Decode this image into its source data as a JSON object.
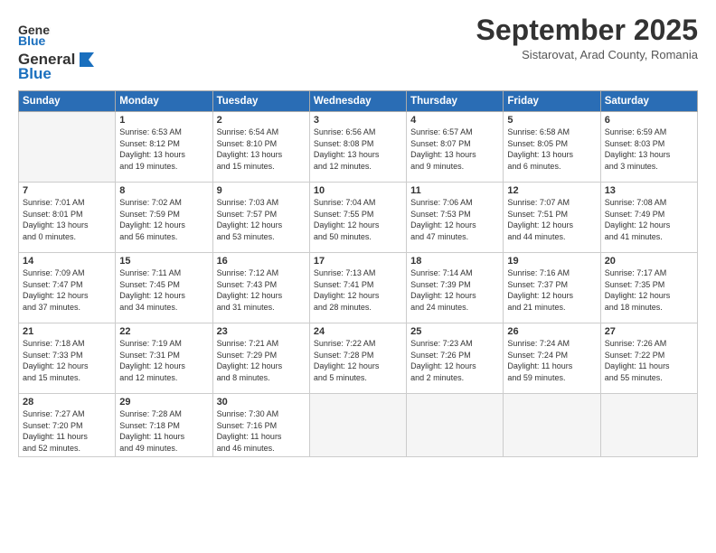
{
  "header": {
    "logo_general": "General",
    "logo_blue": "Blue",
    "month_title": "September 2025",
    "location": "Sistarovat, Arad County, Romania"
  },
  "weekdays": [
    "Sunday",
    "Monday",
    "Tuesday",
    "Wednesday",
    "Thursday",
    "Friday",
    "Saturday"
  ],
  "weeks": [
    [
      {
        "day": "",
        "info": ""
      },
      {
        "day": "1",
        "info": "Sunrise: 6:53 AM\nSunset: 8:12 PM\nDaylight: 13 hours\nand 19 minutes."
      },
      {
        "day": "2",
        "info": "Sunrise: 6:54 AM\nSunset: 8:10 PM\nDaylight: 13 hours\nand 15 minutes."
      },
      {
        "day": "3",
        "info": "Sunrise: 6:56 AM\nSunset: 8:08 PM\nDaylight: 13 hours\nand 12 minutes."
      },
      {
        "day": "4",
        "info": "Sunrise: 6:57 AM\nSunset: 8:07 PM\nDaylight: 13 hours\nand 9 minutes."
      },
      {
        "day": "5",
        "info": "Sunrise: 6:58 AM\nSunset: 8:05 PM\nDaylight: 13 hours\nand 6 minutes."
      },
      {
        "day": "6",
        "info": "Sunrise: 6:59 AM\nSunset: 8:03 PM\nDaylight: 13 hours\nand 3 minutes."
      }
    ],
    [
      {
        "day": "7",
        "info": "Sunrise: 7:01 AM\nSunset: 8:01 PM\nDaylight: 13 hours\nand 0 minutes."
      },
      {
        "day": "8",
        "info": "Sunrise: 7:02 AM\nSunset: 7:59 PM\nDaylight: 12 hours\nand 56 minutes."
      },
      {
        "day": "9",
        "info": "Sunrise: 7:03 AM\nSunset: 7:57 PM\nDaylight: 12 hours\nand 53 minutes."
      },
      {
        "day": "10",
        "info": "Sunrise: 7:04 AM\nSunset: 7:55 PM\nDaylight: 12 hours\nand 50 minutes."
      },
      {
        "day": "11",
        "info": "Sunrise: 7:06 AM\nSunset: 7:53 PM\nDaylight: 12 hours\nand 47 minutes."
      },
      {
        "day": "12",
        "info": "Sunrise: 7:07 AM\nSunset: 7:51 PM\nDaylight: 12 hours\nand 44 minutes."
      },
      {
        "day": "13",
        "info": "Sunrise: 7:08 AM\nSunset: 7:49 PM\nDaylight: 12 hours\nand 41 minutes."
      }
    ],
    [
      {
        "day": "14",
        "info": "Sunrise: 7:09 AM\nSunset: 7:47 PM\nDaylight: 12 hours\nand 37 minutes."
      },
      {
        "day": "15",
        "info": "Sunrise: 7:11 AM\nSunset: 7:45 PM\nDaylight: 12 hours\nand 34 minutes."
      },
      {
        "day": "16",
        "info": "Sunrise: 7:12 AM\nSunset: 7:43 PM\nDaylight: 12 hours\nand 31 minutes."
      },
      {
        "day": "17",
        "info": "Sunrise: 7:13 AM\nSunset: 7:41 PM\nDaylight: 12 hours\nand 28 minutes."
      },
      {
        "day": "18",
        "info": "Sunrise: 7:14 AM\nSunset: 7:39 PM\nDaylight: 12 hours\nand 24 minutes."
      },
      {
        "day": "19",
        "info": "Sunrise: 7:16 AM\nSunset: 7:37 PM\nDaylight: 12 hours\nand 21 minutes."
      },
      {
        "day": "20",
        "info": "Sunrise: 7:17 AM\nSunset: 7:35 PM\nDaylight: 12 hours\nand 18 minutes."
      }
    ],
    [
      {
        "day": "21",
        "info": "Sunrise: 7:18 AM\nSunset: 7:33 PM\nDaylight: 12 hours\nand 15 minutes."
      },
      {
        "day": "22",
        "info": "Sunrise: 7:19 AM\nSunset: 7:31 PM\nDaylight: 12 hours\nand 12 minutes."
      },
      {
        "day": "23",
        "info": "Sunrise: 7:21 AM\nSunset: 7:29 PM\nDaylight: 12 hours\nand 8 minutes."
      },
      {
        "day": "24",
        "info": "Sunrise: 7:22 AM\nSunset: 7:28 PM\nDaylight: 12 hours\nand 5 minutes."
      },
      {
        "day": "25",
        "info": "Sunrise: 7:23 AM\nSunset: 7:26 PM\nDaylight: 12 hours\nand 2 minutes."
      },
      {
        "day": "26",
        "info": "Sunrise: 7:24 AM\nSunset: 7:24 PM\nDaylight: 11 hours\nand 59 minutes."
      },
      {
        "day": "27",
        "info": "Sunrise: 7:26 AM\nSunset: 7:22 PM\nDaylight: 11 hours\nand 55 minutes."
      }
    ],
    [
      {
        "day": "28",
        "info": "Sunrise: 7:27 AM\nSunset: 7:20 PM\nDaylight: 11 hours\nand 52 minutes."
      },
      {
        "day": "29",
        "info": "Sunrise: 7:28 AM\nSunset: 7:18 PM\nDaylight: 11 hours\nand 49 minutes."
      },
      {
        "day": "30",
        "info": "Sunrise: 7:30 AM\nSunset: 7:16 PM\nDaylight: 11 hours\nand 46 minutes."
      },
      {
        "day": "",
        "info": ""
      },
      {
        "day": "",
        "info": ""
      },
      {
        "day": "",
        "info": ""
      },
      {
        "day": "",
        "info": ""
      }
    ]
  ]
}
